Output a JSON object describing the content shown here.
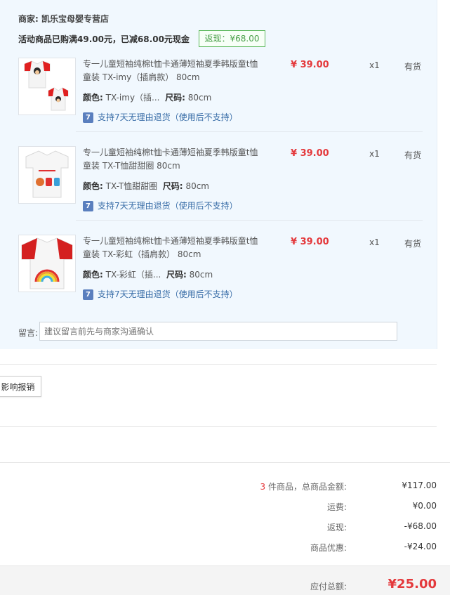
{
  "shop": {
    "label": "商家:",
    "name": "凯乐宝母婴专营店"
  },
  "promo": {
    "text": "活动商品已购满49.00元，已减68.00元现金",
    "rebate_badge": "返现：¥68.00"
  },
  "items": [
    {
      "title": "专一儿童短袖纯棉t恤卡通薄短袖夏季韩版童t恤童装 TX-imy（插肩款） 80cm",
      "price": "¥ 39.00",
      "qty": "x1",
      "stock": "有货",
      "color_label": "颜色:",
      "color": "TX-imy（插...",
      "size_label": "尺码:",
      "size": "80cm",
      "return_text": "支持7天无理由退货（使用后不支持）",
      "return_icon": "7"
    },
    {
      "title": "专一儿童短袖纯棉t恤卡通薄短袖夏季韩版童t恤童装 TX-T恤甜甜圈 80cm",
      "price": "¥ 39.00",
      "qty": "x1",
      "stock": "有货",
      "color_label": "颜色:",
      "color": "TX-T恤甜甜圈",
      "size_label": "尺码:",
      "size": "80cm",
      "return_text": "支持7天无理由退货（使用后不支持）",
      "return_icon": "7"
    },
    {
      "title": "专一儿童短袖纯棉t恤卡通薄短袖夏季韩版童t恤童装 TX-彩虹（插肩款） 80cm",
      "price": "¥ 39.00",
      "qty": "x1",
      "stock": "有货",
      "color_label": "颜色:",
      "color": "TX-彩虹（插...",
      "size_label": "尺码:",
      "size": "80cm",
      "return_text": "支持7天无理由退货（使用后不支持）",
      "return_icon": "7"
    }
  ],
  "message": {
    "label": "留言:",
    "placeholder": "建议留言前先与商家沟通确认"
  },
  "report_button": "影响报销",
  "summary": {
    "count": "3",
    "goods_label": " 件商品，总商品金额:",
    "goods_value": "¥117.00",
    "shipping_label": "运费:",
    "shipping_value": "¥0.00",
    "rebate_label": "返现:",
    "rebate_value": "-¥68.00",
    "discount_label": "商品优惠:",
    "discount_value": "-¥24.00",
    "total_label": "应付总额:",
    "total_value": "¥25.00"
  },
  "colors": {
    "accent_red": "#e4393c",
    "panel_bg": "#f1f8fe",
    "badge_green": "#5cb85c",
    "link_blue": "#3a6ea8"
  }
}
